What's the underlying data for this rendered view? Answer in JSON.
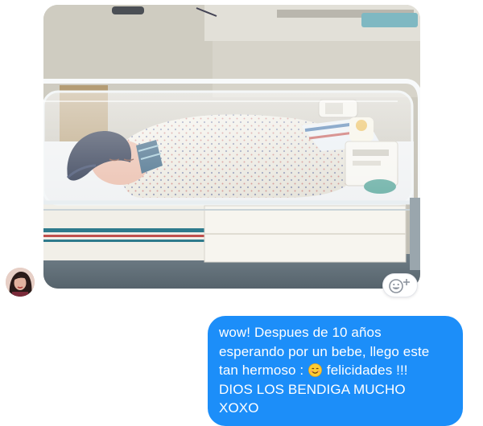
{
  "thread": {
    "incoming": {
      "photo": {
        "subject": "newborn-in-hospital-bassinet"
      },
      "reaction_button": {
        "icon": "smiley-plus-icon"
      },
      "avatar": {
        "icon": "avatar-photo"
      }
    },
    "outgoing": {
      "bubble_color": "#1c8ef9",
      "text_color": "#ffffff",
      "lines": [
        {
          "text": "wow! Despues de 10 años"
        },
        {
          "text": "esperando por un bebe, llego este"
        },
        {
          "before": "tan hermoso : ",
          "emoji": "smiling-face-emoji",
          "after": " felicidades !!!"
        },
        {
          "text": "DIOS LOS BENDIGA MUCHO"
        },
        {
          "text": "XOXO"
        }
      ]
    }
  }
}
